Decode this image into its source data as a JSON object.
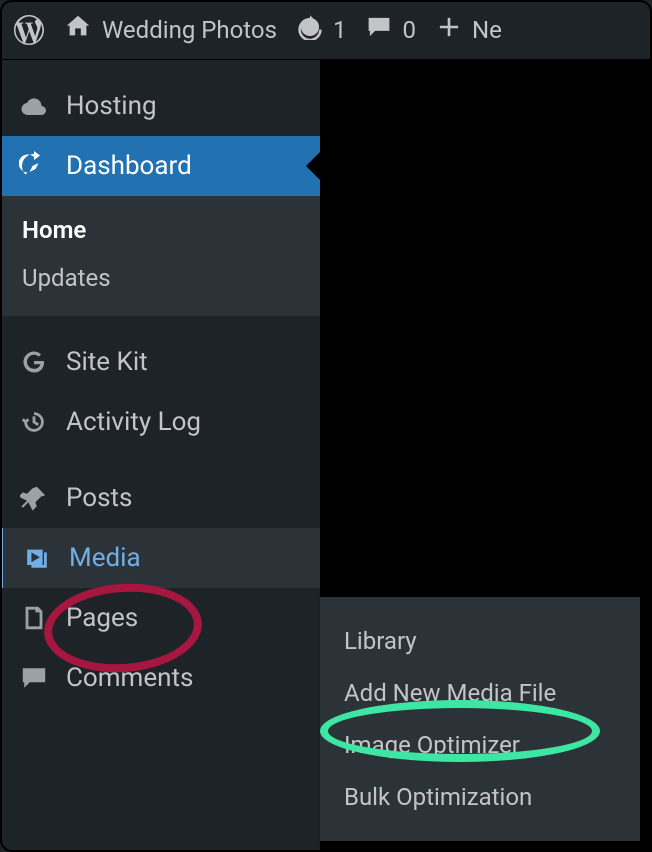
{
  "admin_bar": {
    "site_name": "Wedding Photos",
    "updates_count": "1",
    "comments_count": "0",
    "new_label": "Ne"
  },
  "sidebar": {
    "items": [
      {
        "label": "Hosting",
        "icon": "cloud"
      },
      {
        "label": "Dashboard",
        "icon": "dashboard"
      },
      {
        "label": "Site Kit",
        "icon": "sitekit"
      },
      {
        "label": "Activity Log",
        "icon": "history"
      },
      {
        "label": "Posts",
        "icon": "pin"
      },
      {
        "label": "Media",
        "icon": "media"
      },
      {
        "label": "Pages",
        "icon": "pages"
      },
      {
        "label": "Comments",
        "icon": "comment"
      }
    ],
    "dashboard_submenu": {
      "home": "Home",
      "updates": "Updates"
    },
    "media_flyout": {
      "library": "Library",
      "add_new": "Add New Media File",
      "image_optimizer": "Image Optimizer",
      "bulk_optimization": "Bulk Optimization"
    }
  }
}
